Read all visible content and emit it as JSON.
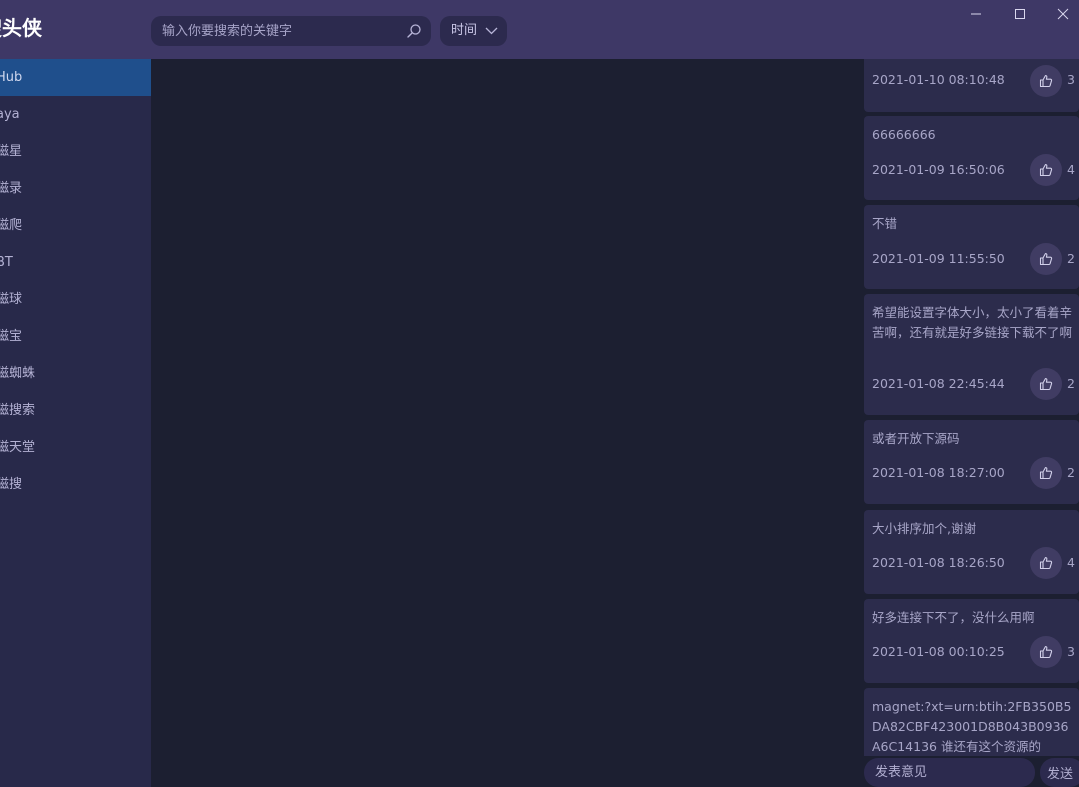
{
  "header": {
    "app_title": "搜头侠",
    "search_placeholder": "输入你要搜索的关键字",
    "sort_label": "时间"
  },
  "sidebar": {
    "items": [
      {
        "label": "Hub",
        "active": true
      },
      {
        "label": "aya"
      },
      {
        "label": "磁星"
      },
      {
        "label": "磁录"
      },
      {
        "label": "磁爬"
      },
      {
        "label": "BT"
      },
      {
        "label": "磁球"
      },
      {
        "label": "磁宝"
      },
      {
        "label": "磁蜘蛛"
      },
      {
        "label": "磁搜索"
      },
      {
        "label": "磁天堂"
      },
      {
        "label": "磁搜"
      }
    ]
  },
  "comments": [
    {
      "text": "",
      "time": "2021-01-10 08:10:48",
      "likes": "3"
    },
    {
      "text": "66666666",
      "time": "2021-01-09 16:50:06",
      "likes": "4"
    },
    {
      "text": "不错",
      "time": "2021-01-09 11:55:50",
      "likes": "2"
    },
    {
      "text": "希望能设置字体大小，太小了看着辛苦啊，还有就是好多链接下载不了啊",
      "time": "2021-01-08 22:45:44",
      "likes": "2"
    },
    {
      "text": "或者开放下源码",
      "time": "2021-01-08 18:27:00",
      "likes": "2"
    },
    {
      "text": "大小排序加个,谢谢",
      "time": "2021-01-08 18:26:50",
      "likes": "4"
    },
    {
      "text": "好多连接下不了，没什么用啊",
      "time": "2021-01-08 00:10:25",
      "likes": "3"
    },
    {
      "text": "magnet:?xt=urn:btih:2FB350B5DA82CBF423001D8B043B0936A6C14136 谁还有这个资源的",
      "time": "",
      "likes": ""
    }
  ],
  "comment_box": {
    "placeholder": "发表意见",
    "send_label": "发送"
  },
  "colors": {
    "titlebar": "#3e3866",
    "sidebar": "#28294a",
    "active": "#1f4f8c",
    "content": "#1c1f31",
    "card": "#2c2c4c"
  }
}
